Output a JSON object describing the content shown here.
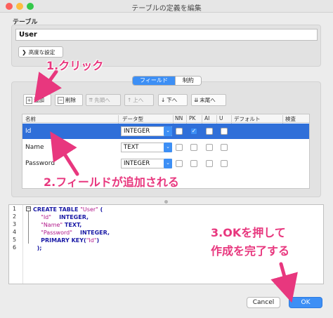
{
  "window": {
    "title": "テーブルの定義を編集",
    "traffic_colors": [
      "#fc605c",
      "#fdbc40",
      "#34c84a"
    ]
  },
  "table_section": {
    "label": "テーブル",
    "name_value": "User",
    "advanced_label": "高度な設定"
  },
  "tabs": {
    "fields": "フィールド",
    "constraints": "制約"
  },
  "toolbar": {
    "add": "追加",
    "delete": "削除",
    "move_first": "先頭へ",
    "move_up": "上へ",
    "move_down": "下へ",
    "move_last": "末尾へ"
  },
  "grid": {
    "headers": {
      "name": "名前",
      "type": "データ型",
      "nn": "NN",
      "pk": "PK",
      "ai": "AI",
      "u": "U",
      "default": "デフォルト",
      "check": "検査"
    },
    "rows": [
      {
        "name": "Id",
        "type": "INTEGER",
        "nn": false,
        "pk": true,
        "ai": false,
        "u": false,
        "selected": true
      },
      {
        "name": "Name",
        "type": "TEXT",
        "nn": false,
        "pk": false,
        "ai": false,
        "u": false,
        "selected": false
      },
      {
        "name": "Password",
        "type": "INTEGER",
        "nn": false,
        "pk": false,
        "ai": false,
        "u": false,
        "selected": false
      }
    ]
  },
  "sql": {
    "line_numbers": [
      "1",
      "2",
      "3",
      "4",
      "5",
      "6"
    ],
    "line1": "CREATE TABLE ",
    "line1_str": "\"User\"",
    "line1_end": " (",
    "line2_str": "\"Id\"",
    "line2_rest": "    INTEGER,",
    "line3_str": "\"Name\"",
    "line3_rest": " TEXT,",
    "line4_str": "\"Password\"",
    "line4_rest": "    INTEGER,",
    "line5": "PRIMARY KEY(",
    "line5_str": "\"Id\"",
    "line5_end": ")",
    "line6": ");"
  },
  "annotations": {
    "step1": "1.クリック",
    "step2": "2.フィールドが追加される",
    "step3_line1": "3.OKを押して",
    "step3_line2": "作成を完了する",
    "color": "#e8377e"
  },
  "buttons": {
    "cancel": "Cancel",
    "ok": "OK"
  }
}
